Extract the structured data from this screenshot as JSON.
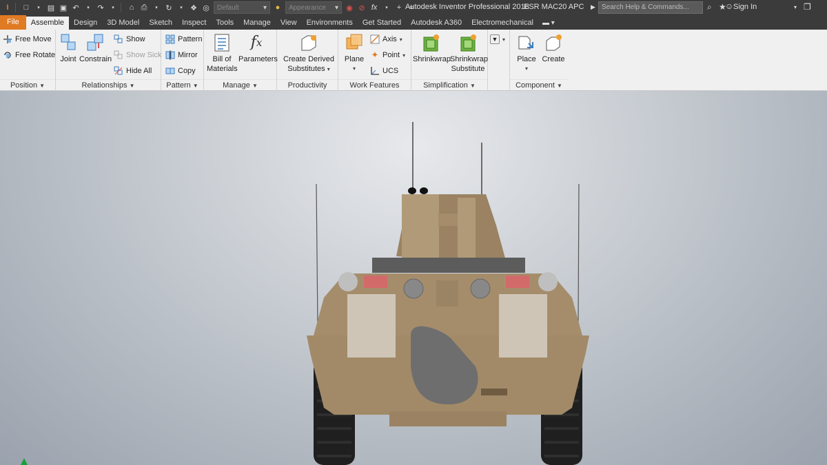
{
  "titlebar": {
    "app_title": "Autodesk Inventor Professional 2018",
    "document": "ESR MAC20 APC",
    "appearance_combo": "Default",
    "material_combo": "Appearance",
    "search_placeholder": "Search Help & Commands...",
    "signin_label": "Sign In"
  },
  "tabs": [
    {
      "label": "File"
    },
    {
      "label": "Assemble"
    },
    {
      "label": "Design"
    },
    {
      "label": "3D Model"
    },
    {
      "label": "Sketch"
    },
    {
      "label": "Inspect"
    },
    {
      "label": "Tools"
    },
    {
      "label": "Manage"
    },
    {
      "label": "View"
    },
    {
      "label": "Environments"
    },
    {
      "label": "Get Started"
    },
    {
      "label": "Autodesk A360"
    },
    {
      "label": "Electromechanical"
    }
  ],
  "ribbon": {
    "position": {
      "title": "Position",
      "free_move": "Free Move",
      "free_rotate": "Free Rotate"
    },
    "relationships": {
      "title": "Relationships",
      "joint": "Joint",
      "constrain": "Constrain",
      "show": "Show",
      "show_sick": "Show Sick",
      "hide_all": "Hide All"
    },
    "pattern": {
      "title": "Pattern",
      "pattern": "Pattern",
      "mirror": "Mirror",
      "copy": "Copy"
    },
    "manage": {
      "title": "Manage",
      "bom_line1": "Bill of",
      "bom_line2": "Materials",
      "parameters": "Parameters"
    },
    "productivity": {
      "title": "Productivity",
      "derived_line1": "Create Derived",
      "derived_line2": "Substitutes"
    },
    "work_features": {
      "title": "Work Features",
      "plane": "Plane",
      "axis": "Axis",
      "point": "Point",
      "ucs": "UCS"
    },
    "simplification": {
      "title": "Simplification",
      "shrinkwrap": "Shrinkwrap",
      "sub_line1": "Shrinkwrap",
      "sub_line2": "Substitute"
    },
    "component": {
      "title": "Component",
      "place": "Place",
      "create": "Create"
    }
  },
  "colors": {
    "file_tab": "#e07a23",
    "titlebar": "#3b3b3b",
    "ribbon": "#f0f0f0",
    "vehicle_body": "#a89272"
  }
}
